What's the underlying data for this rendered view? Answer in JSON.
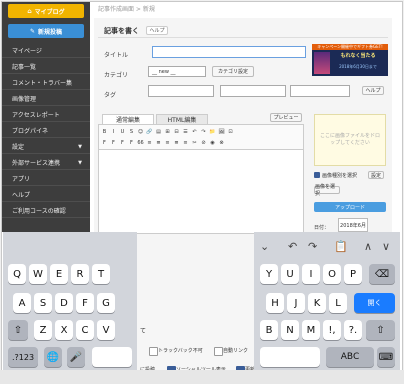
{
  "breadcrumb": "記事作成画面 > 新規",
  "sidebar": {
    "mypage_label": "マイブログ",
    "new_post_label": "新規投稿",
    "items": [
      {
        "label": "マイページ",
        "arrow": ""
      },
      {
        "label": "記事一覧",
        "arrow": ""
      },
      {
        "label": "コメント・トラバー集",
        "arrow": ""
      },
      {
        "label": "画像管理",
        "arrow": ""
      },
      {
        "label": "アクセスレポート",
        "arrow": ""
      },
      {
        "label": "ブログパイネ",
        "arrow": ""
      },
      {
        "label": "設定",
        "arrow": "▼"
      },
      {
        "label": "外部サービス連携",
        "arrow": "▼"
      },
      {
        "label": "アプリ",
        "arrow": ""
      },
      {
        "label": "ヘルプ",
        "arrow": ""
      },
      {
        "label": "ご利用コースの確認",
        "arrow": ""
      }
    ]
  },
  "editor": {
    "heading": "記事を書く",
    "help_label": "ヘルプ",
    "title_label": "タイトル",
    "category_label": "カテゴリ",
    "category_value": "__ new __",
    "category_settings": "カテゴリ設定",
    "tag_label": "タグ",
    "tag_help": "ヘルプ",
    "tab_standard": "通常編集",
    "tab_html": "HTML編集",
    "preview_label": "プレビュー"
  },
  "ad": {
    "top": "キャンペーン開催中でギフト券GET!",
    "main": "もれなく当たる",
    "sub": "2018年6月30日まで"
  },
  "side_panel": {
    "drop_text": "ここに画像ファイルをドロップしてください",
    "check_label": "画像種別を選択",
    "check_btn": "設定",
    "select_btn": "画像を選択",
    "upload_btn": "アップロード",
    "date_label": "日付：",
    "date_value": "2018年6月"
  },
  "toolbar_icons": [
    "B",
    "I",
    "U",
    "S",
    "☺",
    "🔗",
    "▤",
    "⊞",
    "⊟",
    "☰",
    "↶",
    "↷",
    "📁",
    "🖼",
    "⊡"
  ],
  "toolbar_icons_row2": [
    "F",
    "F",
    "F",
    "F",
    "66",
    "≡",
    "≣",
    "≡",
    "≣",
    "≡",
    "✂",
    "⊘",
    "◉",
    "⊗"
  ],
  "bottom_options": {
    "trackback": "トラックバック不可",
    "autolink": "自動リンク",
    "social": "ソーシャルツール表示",
    "more": "更新",
    "post": "に投稿",
    "te": "て"
  },
  "keyboard_left": {
    "row1": [
      "Q",
      "W",
      "E",
      "R",
      "T"
    ],
    "row2": [
      "A",
      "S",
      "D",
      "F",
      "G"
    ],
    "row3": [
      "Z",
      "X",
      "C",
      "V"
    ],
    "shift": "⇧",
    "num": ".?123",
    "globe": "🌐",
    "mic": "🎤"
  },
  "keyboard_right": {
    "row1": [
      "Y",
      "U",
      "I",
      "O",
      "P"
    ],
    "row2": [
      "H",
      "J",
      "K",
      "L"
    ],
    "row3": [
      "B",
      "N",
      "M",
      "!,",
      "?."
    ],
    "backspace": "⌫",
    "enter": "開く",
    "shift": "⇧",
    "abc": "ABC",
    "kbd": "⌨",
    "top_left": "⌄",
    "undo": "↶",
    "redo": "↷",
    "paste": "📋",
    "up": "∧",
    "down": "∨"
  },
  "colors": {
    "sidebar_bg": "#3d3d3d",
    "mypage": "#f1b400",
    "new_post": "#3a8fd6",
    "enter": "#1a7cff"
  }
}
